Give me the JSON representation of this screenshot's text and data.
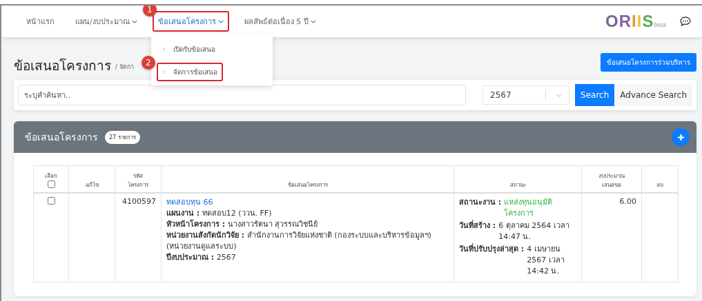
{
  "nav": {
    "items": [
      {
        "label": "หน้าแรก",
        "caret": false,
        "selected": false,
        "highlighted": false
      },
      {
        "label": "แผน/งบประมาณ",
        "caret": true,
        "selected": false,
        "highlighted": false
      },
      {
        "label": "ข้อเสนอโครงการ",
        "caret": true,
        "selected": true,
        "highlighted": true,
        "marker": "1"
      },
      {
        "label": "ผลลัพธ์ต่อเนื่อง 5 ปี",
        "caret": true,
        "selected": false,
        "highlighted": false
      }
    ],
    "dropdown": [
      {
        "label": "เปิดรับข้อเสนอ",
        "highlighted": false
      },
      {
        "label": "จัดการข้อเสนอ",
        "highlighted": true,
        "marker": "2"
      }
    ],
    "logo": {
      "letters": [
        {
          "text": "O",
          "color": "#6f6a9a"
        },
        {
          "text": "R",
          "color": "#8a62a8"
        },
        {
          "text": "I",
          "color": "#e8963a"
        },
        {
          "text": "I",
          "color": "#e9c53c"
        },
        {
          "text": "S",
          "color": "#5aa65a"
        }
      ],
      "suffix": "beta"
    }
  },
  "page": {
    "title": "ข้อเสนอโครงการ",
    "breadcrumb": "/ จัดกา",
    "action_button": "ข้อเสนอโครงการร่วมบริหาร"
  },
  "search": {
    "placeholder": "ระบุคำค้นหา..",
    "year": "2567",
    "search_button": "Search",
    "advance_button": "Advance Search"
  },
  "panel": {
    "title": "ข้อเสนอโครงการ",
    "count": "27 รายการ"
  },
  "table": {
    "columns": [
      "เลือก",
      "แก้ไข",
      "รหัส\nโครงการ",
      "ข้อเสนอโครงการ",
      "สถานะ",
      "งบประมาณ\nเสนอขอ",
      "ลบ"
    ],
    "select_all_checked": false,
    "rows": [
      {
        "checked": false,
        "code": "4100597",
        "title": "ทดสอบทุน 66",
        "details": [
          {
            "label": "แผนงาน :",
            "value": "ทดสอบ12 (ววน. FF)"
          },
          {
            "label": "หัวหน้าโครงการ :",
            "value": "นางสาวรัตนา สุวรรณวิชนีย์"
          },
          {
            "label": "หน่วยงานสังกัดนักวิจัย :",
            "value": "สำนักงานการวิจัยแห่งชาติ (กองระบบและบริหารข้อมูลฯ)(หน่วยงานดูแลระบบ)"
          },
          {
            "label": "ปีงบประมาณ :",
            "value": "2567"
          }
        ],
        "status": [
          {
            "kind": "status",
            "label": "สถานะงาน :",
            "value": "แหล่งทุนอนุมัติโครงการ"
          },
          {
            "kind": "date",
            "label": "วันที่สร้าง :",
            "value": "6 ตุลาคม 2564 เวลา 14:47 น."
          },
          {
            "kind": "date",
            "label": "วันที่ปรับปรุงล่าสุด :",
            "value": "4 เมษายน 2567 เวลา 14:42 น."
          }
        ],
        "budget": "6.00"
      }
    ]
  }
}
